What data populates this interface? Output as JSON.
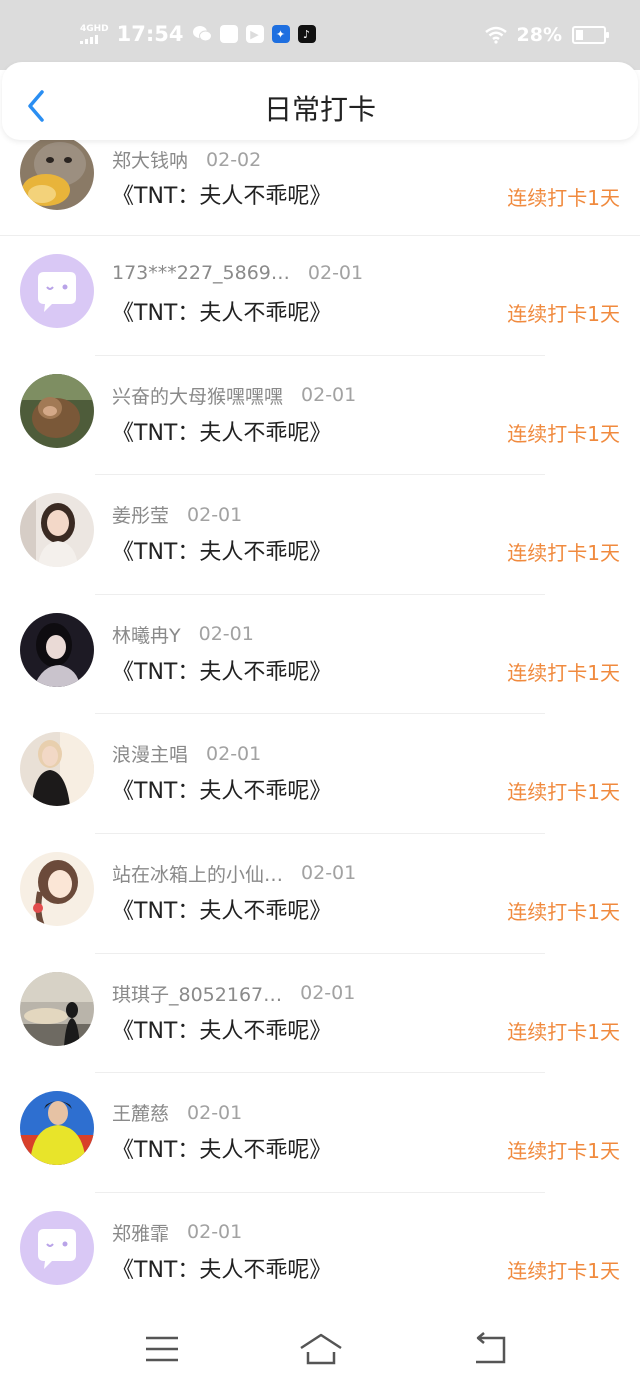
{
  "status": {
    "network": "4GHD",
    "time": "17:54",
    "battery": "28%",
    "battery_level": 0.28
  },
  "header": {
    "title": "日常打卡"
  },
  "records": [
    {
      "name": "郑大钱呐",
      "date": "02-02",
      "book": "《TNT：夫人不乖呢》",
      "streak": "连续打卡1天",
      "avatar": "cat-photo-avatar"
    },
    {
      "name": "173***227_5869…",
      "date": "02-01",
      "book": "《TNT：夫人不乖呢》",
      "streak": "连续打卡1天",
      "avatar": "default-chat-avatar"
    },
    {
      "name": "兴奋的大母猴嘿嘿嘿",
      "date": "02-01",
      "book": "《TNT：夫人不乖呢》",
      "streak": "连续打卡1天",
      "avatar": "monkey-photo-avatar"
    },
    {
      "name": "姜彤莹",
      "date": "02-01",
      "book": "《TNT：夫人不乖呢》",
      "streak": "连续打卡1天",
      "avatar": "girl-photo-avatar"
    },
    {
      "name": "林曦冉Y",
      "date": "02-01",
      "book": "《TNT：夫人不乖呢》",
      "streak": "连续打卡1天",
      "avatar": "girl-dark-photo-avatar"
    },
    {
      "name": "浪漫主唱",
      "date": "02-01",
      "book": "《TNT：夫人不乖呢》",
      "streak": "连续打卡1天",
      "avatar": "singer-photo-avatar"
    },
    {
      "name": "站在冰箱上的小仙…",
      "date": "02-01",
      "book": "《TNT：夫人不乖呢》",
      "streak": "连续打卡1天",
      "avatar": "illustrated-girl-avatar"
    },
    {
      "name": "琪琪子_8052167…",
      "date": "02-01",
      "book": "《TNT：夫人不乖呢》",
      "streak": "连续打卡1天",
      "avatar": "sunset-silhouette-avatar"
    },
    {
      "name": "王麓慈",
      "date": "02-01",
      "book": "《TNT：夫人不乖呢》",
      "streak": "连续打卡1天",
      "avatar": "yellow-shirt-photo-avatar"
    },
    {
      "name": "郑雅霏",
      "date": "02-01",
      "book": "《TNT：夫人不乖呢》",
      "streak": "连续打卡1天",
      "avatar": "default-chat-avatar"
    }
  ],
  "colors": {
    "accent_blue": "#2a8ef2",
    "streak_orange": "#f08a3e",
    "status_bar": "#dcdcdc",
    "default_avatar": "#d9c8f5"
  }
}
